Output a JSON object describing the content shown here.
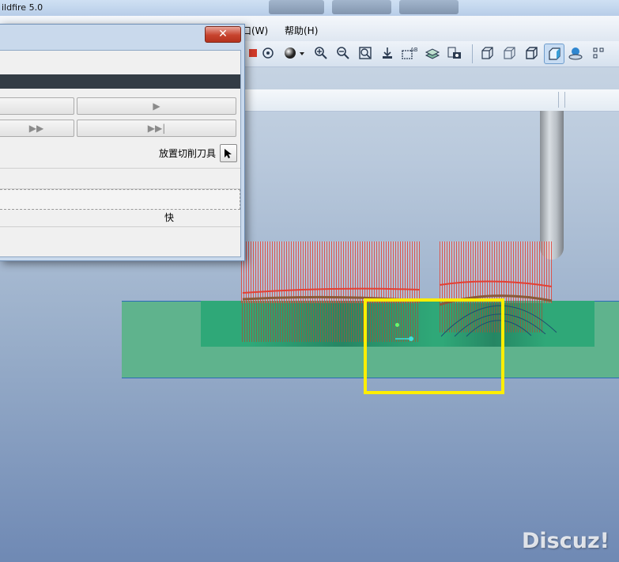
{
  "window": {
    "title": "ildfire 5.0"
  },
  "menu": {
    "window_label": "口(W)",
    "help_label": "帮助(H)"
  },
  "toolbar": {
    "icons": [
      "shading-icon",
      "sphere-icon",
      "zoom-in-icon",
      "zoom-out-icon",
      "refit-icon",
      "orient-icon",
      "named-view-icon",
      "layers-icon",
      "camera-icon",
      "wireframe-icon",
      "hidden-line-icon",
      "no-hidden-icon",
      "shaded-icon",
      "spin-center-icon",
      "datum-display-icon"
    ]
  },
  "dialog": {
    "close_glyph": "✕",
    "play_glyph": "▶",
    "fast_forward_glyph": "▶▶",
    "end_glyph": "▶▶|",
    "place_tool_label": "放置切削刀具",
    "speed_label": "快"
  },
  "watermark": {
    "text": "Discuz!"
  },
  "colors": {
    "highlight": "#ffee00",
    "stock": "#5fb38d",
    "toolpath": "#e24034"
  }
}
